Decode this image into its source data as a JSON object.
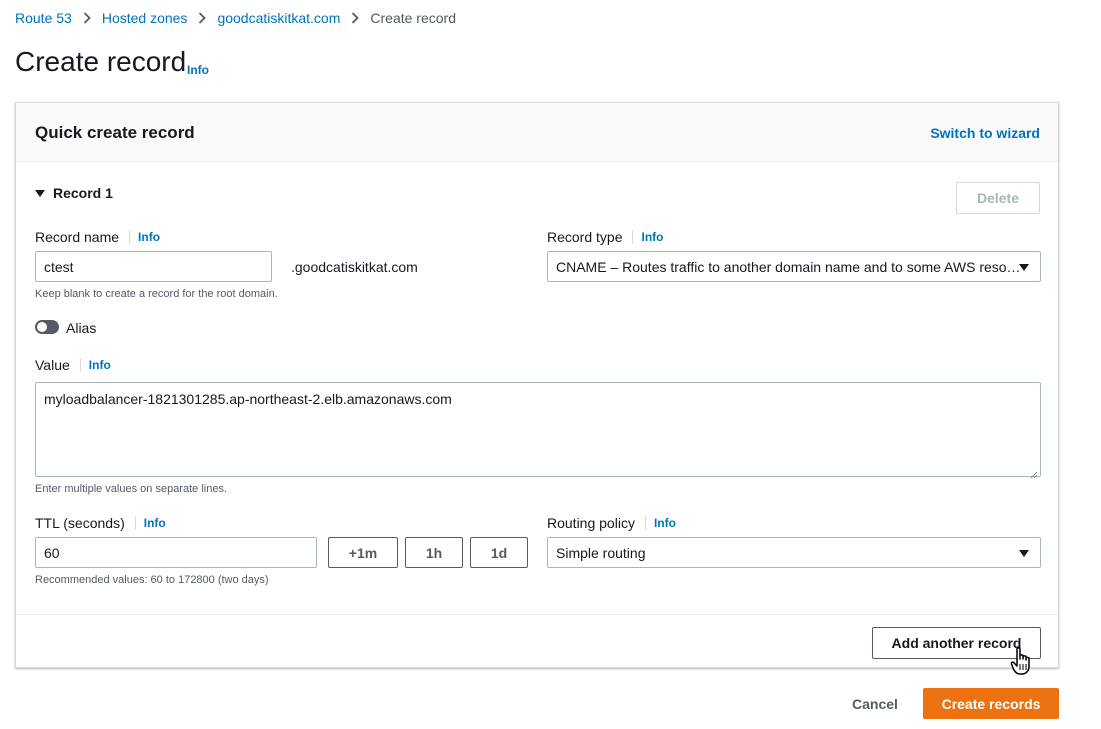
{
  "breadcrumb": {
    "items": [
      "Route 53",
      "Hosted zones",
      "goodcatiskitkat.com"
    ],
    "current": "Create record"
  },
  "header": {
    "title": "Create record",
    "info": "Info"
  },
  "panel": {
    "title": "Quick create record",
    "switch_label": "Switch to wizard",
    "record_label": "Record 1",
    "delete_label": "Delete",
    "record_name": {
      "label": "Record name",
      "info": "Info",
      "value": "ctest",
      "suffix": ".goodcatiskitkat.com",
      "hint": "Keep blank to create a record for the root domain."
    },
    "record_type": {
      "label": "Record type",
      "info": "Info",
      "value": "CNAME – Routes traffic to another domain name and to some AWS reso…"
    },
    "alias": {
      "label": "Alias",
      "enabled": false
    },
    "value_field": {
      "label": "Value",
      "info": "Info",
      "value": "myloadbalancer-1821301285.ap-northeast-2.elb.amazonaws.com",
      "hint": "Enter multiple values on separate lines."
    },
    "ttl": {
      "label": "TTL (seconds)",
      "info": "Info",
      "value": "60",
      "buttons": [
        "+1m",
        "1h",
        "1d"
      ],
      "hint": "Recommended values: 60 to 172800 (two days)"
    },
    "routing": {
      "label": "Routing policy",
      "info": "Info",
      "value": "Simple routing"
    },
    "add_label": "Add another record"
  },
  "footer": {
    "cancel_label": "Cancel",
    "create_label": "Create records"
  },
  "colors": {
    "link": "#0073bb",
    "primary": "#ec7211",
    "border": "#aab7b8",
    "text": "#16191f"
  },
  "icons": [
    "chevron-right-icon",
    "caret-down-icon",
    "toggle-off-icon",
    "hand-pointer-icon"
  ]
}
